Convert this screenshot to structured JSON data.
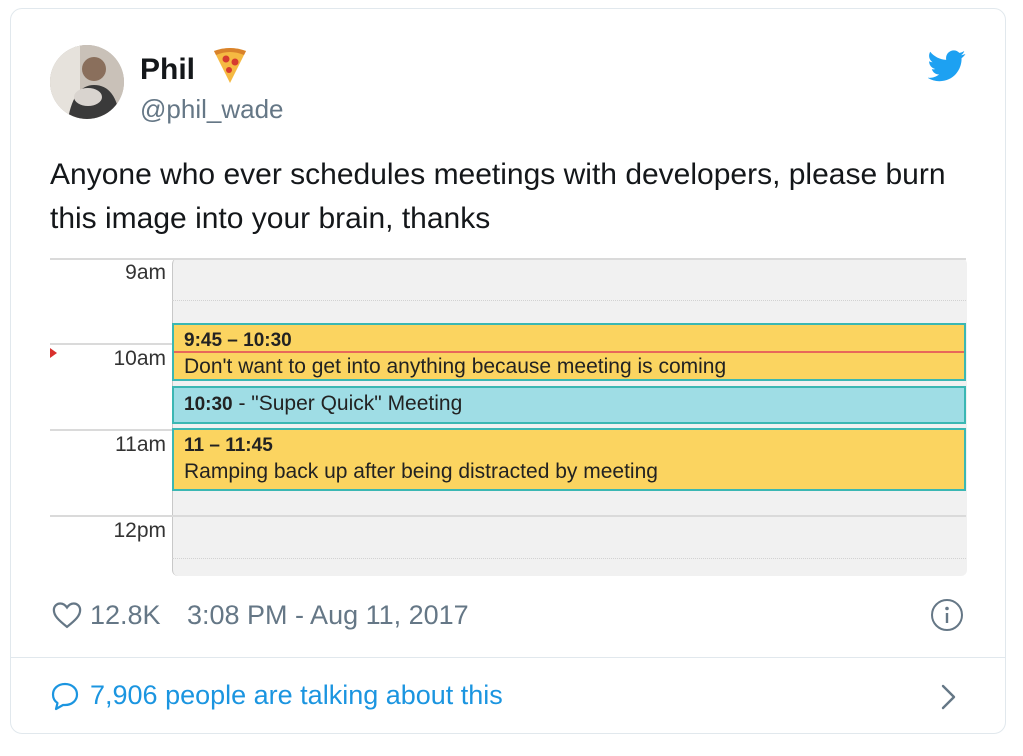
{
  "author": {
    "display_name": "Phil",
    "handle": "@phil_wade",
    "emoji_icon": "pizza-icon"
  },
  "tweet": {
    "text": "Anyone who ever schedules meetings with developers, please burn this image into your brain, thanks"
  },
  "calendar": {
    "hours": [
      "9am",
      "10am",
      "11am",
      "12pm"
    ],
    "events": [
      {
        "time": "9:45 – 10:30",
        "title": "Don't want to get into anything because meeting is coming",
        "color": "#fbd460"
      },
      {
        "time": "10:30",
        "title": " - \"Super Quick\" Meeting",
        "color": "#9fdde5"
      },
      {
        "time": "11 – 11:45",
        "title": "Ramping back up after being distracted by meeting",
        "color": "#fbd460"
      }
    ]
  },
  "footer": {
    "like_count": "12.8K",
    "timestamp": "3:08 PM - Aug 11, 2017",
    "talking": "7,906 people are talking about this"
  },
  "colors": {
    "accent": "#1b95e0",
    "twitter_blue": "#1da1f2",
    "muted": "#657786"
  }
}
